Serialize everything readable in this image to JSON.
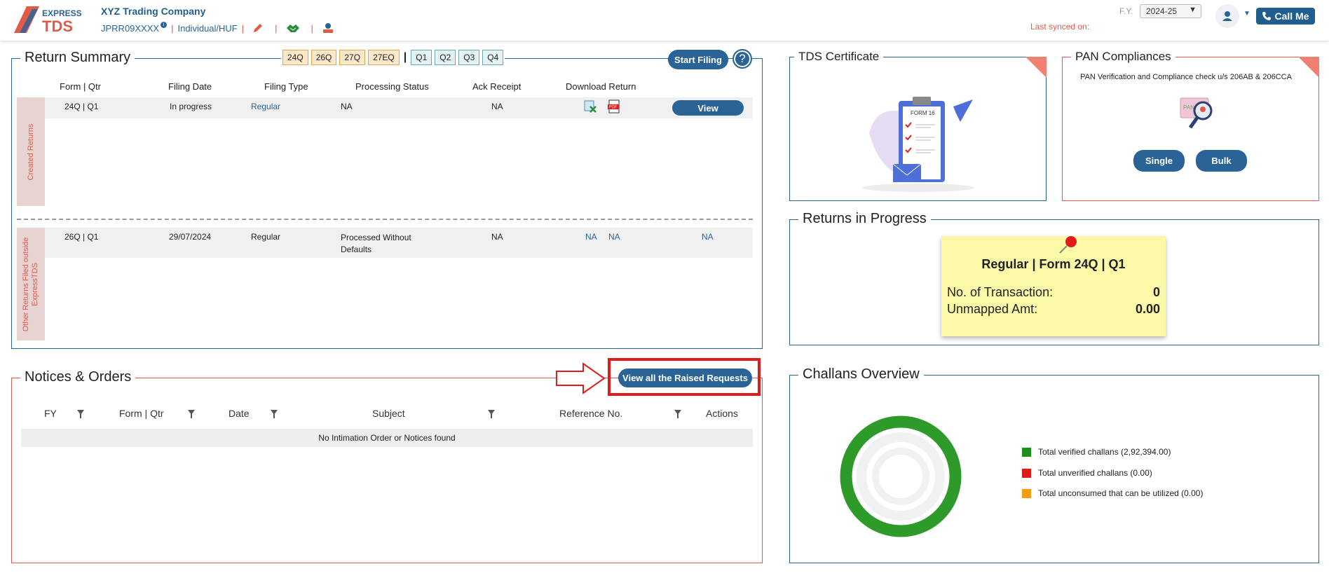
{
  "header": {
    "logo_top": "EXPRESS",
    "logo_bottom": "TDS",
    "company_name": "XYZ Trading Company",
    "pan": "JPRR09XXXX",
    "pan_info_icon": "info-icon",
    "entity_type": "Individual/HUF",
    "sep": "|",
    "fy_label": "F.Y.",
    "fy_value": "2024-25",
    "last_synced": "Last synced on:",
    "call_me": "Call Me"
  },
  "return_summary": {
    "title": "Return Summary",
    "form_chips": [
      "24Q",
      "26Q",
      "27Q",
      "27EQ"
    ],
    "qtr_chips": [
      "Q1",
      "Q2",
      "Q3",
      "Q4"
    ],
    "start_filing": "Start Filing",
    "help": "?",
    "columns": [
      "Form | Qtr",
      "Filing Date",
      "Filing Type",
      "Processing Status",
      "Ack Receipt",
      "Download Return"
    ],
    "created_label": "Created Returns",
    "other_label": "Other Returns Filed outside ExpressTDS",
    "created_rows": [
      {
        "form_qtr": "24Q | Q1",
        "filing_date": "In progress",
        "filing_type": "Regular",
        "status": "NA",
        "ack": "NA",
        "action": "View"
      }
    ],
    "other_rows": [
      {
        "form_qtr": "26Q | Q1",
        "filing_date": "29/07/2024",
        "filing_type": "Regular",
        "status": "Processed Without Defaults",
        "ack": "NA",
        "dl1": "NA",
        "dl2": "NA",
        "action": "NA"
      }
    ]
  },
  "notices": {
    "title": "Notices & Orders",
    "view_all": "View all the Raised Requests",
    "columns": [
      "FY",
      "Form | Qtr",
      "Date",
      "Subject",
      "Reference No.",
      "Actions"
    ],
    "empty": "No Intimation Order or Notices found"
  },
  "tds_certificate": {
    "title": "TDS Certificate",
    "form_label": "FORM 16"
  },
  "pan_compliances": {
    "title": "PAN Compliances",
    "subtitle": "PAN Verification and Compliance check u/s 206AB & 206CCA",
    "single": "Single",
    "bulk": "Bulk",
    "card_text": "PAN"
  },
  "returns_in_progress": {
    "title": "Returns in Progress",
    "card_title": "Regular | Form 24Q | Q1",
    "txn_label": "No. of Transaction:",
    "txn_value": "0",
    "amt_label": "Unmapped Amt:",
    "amt_value": "0.00"
  },
  "challans": {
    "title": "Challans Overview",
    "legend": [
      {
        "label": "Total verified challans (2,92,394.00)",
        "color": "#1a8f1a"
      },
      {
        "label": "Total unverified challans (0.00)",
        "color": "#e01b1b"
      },
      {
        "label": "Total unconsumed that can be utilized (0.00)",
        "color": "#f29d12"
      }
    ]
  },
  "colors": {
    "primary": "#2a6496",
    "accent": "#e05a4a",
    "highlight": "#e01b1b"
  }
}
